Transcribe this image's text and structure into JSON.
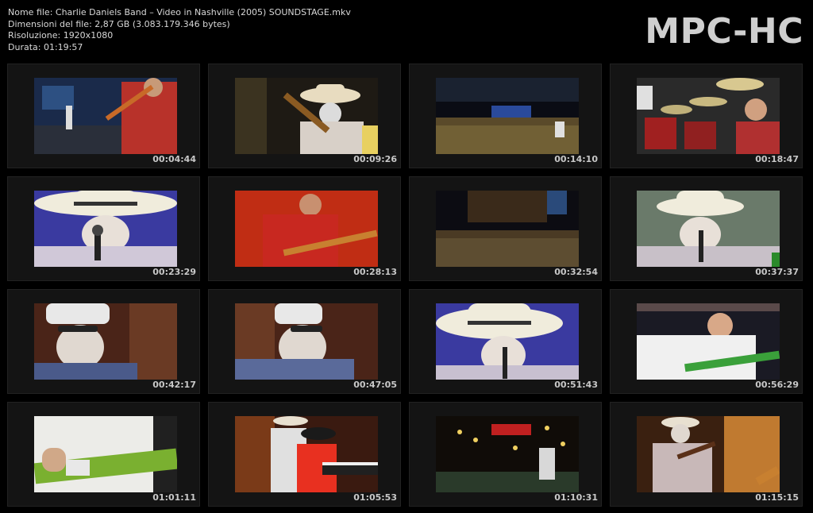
{
  "info": {
    "line1": "Nome file: Charlie Daniels Band – Video in Nashville (2005) SOUNDSTAGE.mkv",
    "line2": "Dimensioni del file: 2,87 GB (3.083.179.346 bytes)",
    "line3": "Risoluzione: 1920x1080",
    "line4": "Durata: 01:19:57"
  },
  "logo": "MPC-HC",
  "thumbs": [
    {
      "time": "00:04:44",
      "scene": "guitarist-red-shirt-stage"
    },
    {
      "time": "00:09:26",
      "scene": "cowboy-hat-guitar"
    },
    {
      "time": "00:14:10",
      "scene": "crowd-night-wide"
    },
    {
      "time": "00:18:47",
      "scene": "drummer"
    },
    {
      "time": "00:23:29",
      "scene": "cowboy-hat-singer-blue"
    },
    {
      "time": "00:28:13",
      "scene": "guitarist-red-background"
    },
    {
      "time": "00:32:54",
      "scene": "crowd-stage-wide"
    },
    {
      "time": "00:37:37",
      "scene": "cowboy-hat-singer-green"
    },
    {
      "time": "00:42:17",
      "scene": "cap-sunglasses-brick"
    },
    {
      "time": "00:47:05",
      "scene": "cap-sunglasses-brick-2"
    },
    {
      "time": "00:51:43",
      "scene": "cowboy-hat-singer-blue-2"
    },
    {
      "time": "00:56:29",
      "scene": "guitarist-white-shirt"
    },
    {
      "time": "01:01:11",
      "scene": "green-guitar-closeup"
    },
    {
      "time": "01:05:53",
      "scene": "band-keyboard"
    },
    {
      "time": "01:10:31",
      "scene": "stage-lights-wide"
    },
    {
      "time": "01:15:15",
      "scene": "fiddler-stage"
    }
  ]
}
